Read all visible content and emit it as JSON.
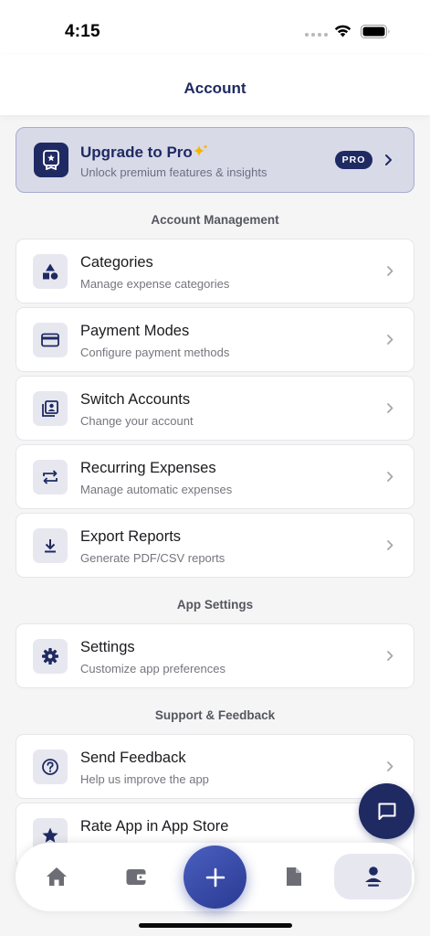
{
  "status_bar": {
    "time": "4:15"
  },
  "header": {
    "title": "Account"
  },
  "upgrade": {
    "title": "Upgrade to Pro",
    "subtitle": "Unlock premium features & insights",
    "badge": "PRO"
  },
  "sections": {
    "account_management": "Account Management",
    "app_settings": "App Settings",
    "support_feedback": "Support & Feedback"
  },
  "menu": {
    "categories": {
      "title": "Categories",
      "subtitle": "Manage expense categories"
    },
    "payment_modes": {
      "title": "Payment Modes",
      "subtitle": "Configure payment methods"
    },
    "switch_accounts": {
      "title": "Switch Accounts",
      "subtitle": "Change your account"
    },
    "recurring_expenses": {
      "title": "Recurring Expenses",
      "subtitle": "Manage automatic expenses"
    },
    "export_reports": {
      "title": "Export Reports",
      "subtitle": "Generate PDF/CSV reports"
    },
    "settings": {
      "title": "Settings",
      "subtitle": "Customize app preferences"
    },
    "send_feedback": {
      "title": "Send Feedback",
      "subtitle": "Help us improve the app"
    },
    "rate_app": {
      "title": "Rate App in App Store"
    }
  },
  "icons": {
    "upgrade": "award-badge-icon",
    "categories": "shapes-icon",
    "payment_modes": "credit-card-icon",
    "switch_accounts": "account-box-icon",
    "recurring_expenses": "repeat-icon",
    "export_reports": "download-icon",
    "settings": "gear-icon",
    "send_feedback": "help-circle-icon",
    "rate_app": "star-icon",
    "chat": "chat-icon",
    "nav": [
      "home-icon",
      "wallet-icon",
      "plus-icon",
      "document-icon",
      "person-icon"
    ]
  },
  "colors": {
    "primary": "#1f2a63",
    "upgrade_bg": "#d8dae8",
    "icon_tile_bg": "#e7e8ef",
    "sparkle": "#f5b400",
    "background": "#f5f5f6"
  },
  "bottom_nav": {
    "active": "account"
  }
}
